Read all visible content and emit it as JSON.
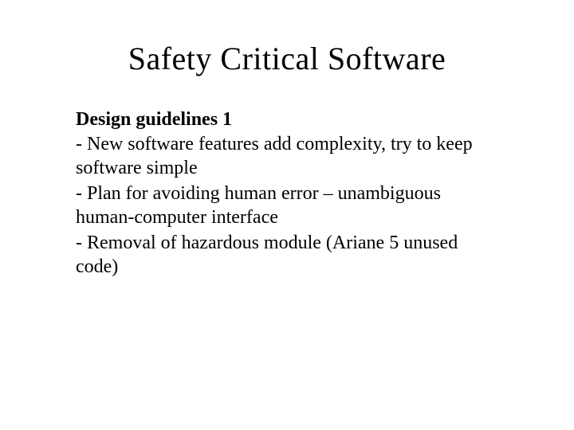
{
  "title": "Safety Critical Software",
  "subtitle": "Design guidelines 1",
  "bullets": [
    "- New software features add complexity, try to keep software simple",
    "- Plan for avoiding human error – unambiguous human-computer interface",
    "- Removal of hazardous module (Ariane 5 unused code)"
  ]
}
